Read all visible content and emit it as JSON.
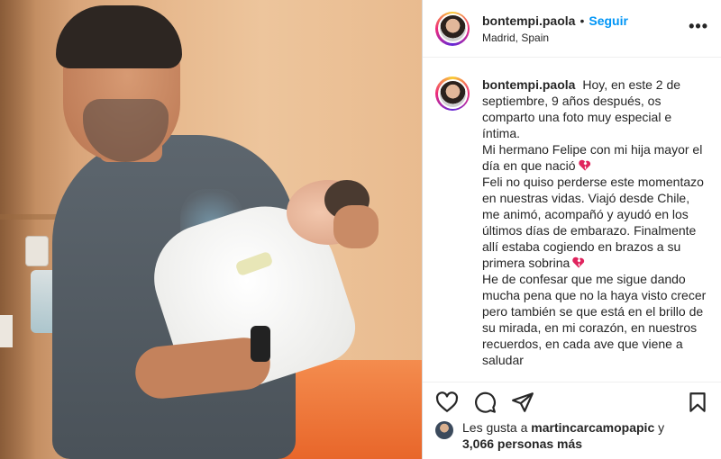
{
  "post": {
    "username": "bontempi.paola",
    "follow_label": "Seguir",
    "separator": "•",
    "location": "Madrid, Spain",
    "more_label": "•••"
  },
  "caption": {
    "username": "bontempi.paola",
    "paragraphs": [
      "Hoy, en este 2 de septiembre, 9 años después, os comparto una foto muy especial e íntima.",
      "Mi hermano Felipe con mi hija mayor el día en que nació",
      "Feli no quiso perderse este momentazo en nuestras vidas. Viajó desde Chile, me animó, acompañó y ayudó en los últimos días de embarazo. Finalmente allí estaba cogiendo en brazos a su primera sobrina",
      "He de confesar que me sigue dando mucha pena que no la haya visto crecer pero también se que está en el brillo de su mirada, en mi corazón, en nuestros recuerdos, en cada ave que viene a saludar"
    ]
  },
  "likes": {
    "prefix": "Les gusta a",
    "user": "martincarcamopapic",
    "conjunction": "y",
    "count": "3,066 personas más"
  },
  "icons": {
    "like": "heart-outline-icon",
    "comment": "comment-bubble-icon",
    "share": "paper-plane-icon",
    "save": "bookmark-icon",
    "emoji_heart": "broken-heart-emoji"
  },
  "colors": {
    "follow_blue": "#0095f6",
    "text": "#262626",
    "emoji_red": "#e0245e"
  }
}
